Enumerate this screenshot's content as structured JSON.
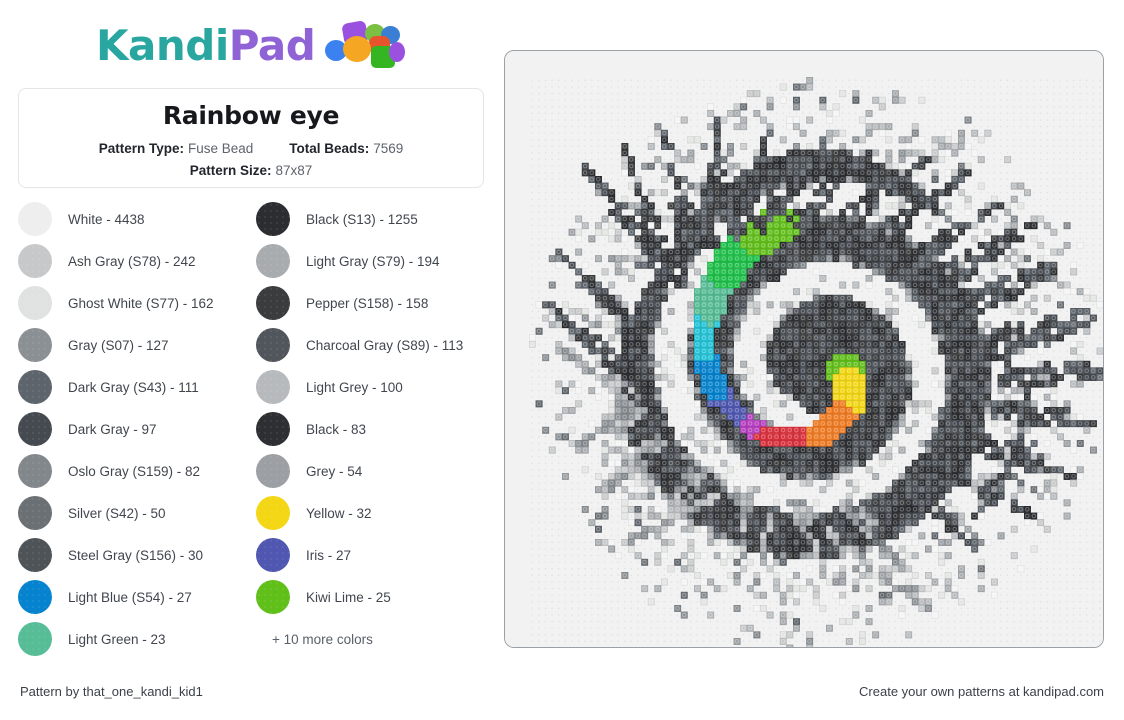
{
  "brand": {
    "name_part1": "Kandi",
    "name_part2": "Pad",
    "colors": {
      "teal": "#2aa6a0",
      "purple": "#8f63d6"
    }
  },
  "card": {
    "title": "Rainbow eye",
    "pattern_type_label": "Pattern Type:",
    "pattern_type_value": "Fuse Bead",
    "total_beads_label": "Total Beads:",
    "total_beads_value": "7569",
    "pattern_size_label": "Pattern Size:",
    "pattern_size_value": "87x87"
  },
  "legend": {
    "more_text": "+ 10 more colors",
    "items": [
      {
        "label": "White - 4438",
        "name": "White",
        "count": 4438,
        "hex": "#eeeeee"
      },
      {
        "label": "Black (S13) - 1255",
        "name": "Black (S13)",
        "count": 1255,
        "hex": "#2b2d30"
      },
      {
        "label": "Ash Gray (S78) - 242",
        "name": "Ash Gray (S78)",
        "count": 242,
        "hex": "#c6c8c9"
      },
      {
        "label": "Light Gray (S79) - 194",
        "name": "Light Gray (S79)",
        "count": 194,
        "hex": "#a8acaf"
      },
      {
        "label": "Ghost White (S77) - 162",
        "name": "Ghost White (S77)",
        "count": 162,
        "hex": "#dfe2e0"
      },
      {
        "label": "Pepper (S158) - 158",
        "name": "Pepper (S158)",
        "count": 158,
        "hex": "#3a3c3e"
      },
      {
        "label": "Gray (S07) - 127",
        "name": "Gray (S07)",
        "count": 127,
        "hex": "#8b9095"
      },
      {
        "label": "Charcoal Gray (S89) - 113",
        "name": "Charcoal Gray (S89)",
        "count": 113,
        "hex": "#51565c"
      },
      {
        "label": "Dark Gray (S43) - 111",
        "name": "Dark Gray (S43)",
        "count": 111,
        "hex": "#5d646b"
      },
      {
        "label": "Light Grey - 100",
        "name": "Light Grey",
        "count": 100,
        "hex": "#b7babd"
      },
      {
        "label": "Dark Gray - 97",
        "name": "Dark Gray",
        "count": 97,
        "hex": "#454a51"
      },
      {
        "label": "Black - 83",
        "name": "Black",
        "count": 83,
        "hex": "#2d2f32"
      },
      {
        "label": "Oslo Gray (S159) - 82",
        "name": "Oslo Gray (S159)",
        "count": 82,
        "hex": "#82878c"
      },
      {
        "label": "Grey - 54",
        "name": "Grey",
        "count": 54,
        "hex": "#9ca0a4"
      },
      {
        "label": "Silver (S42) - 50",
        "name": "Silver (S42)",
        "count": 50,
        "hex": "#6b7075"
      },
      {
        "label": "Yellow - 32",
        "name": "Yellow",
        "count": 32,
        "hex": "#f4d714"
      },
      {
        "label": "Steel Gray (S156) - 30",
        "name": "Steel Gray (S156)",
        "count": 30,
        "hex": "#4e5358"
      },
      {
        "label": "Iris - 27",
        "name": "Iris",
        "count": 27,
        "hex": "#4f57b0"
      },
      {
        "label": "Light Blue (S54) - 27",
        "name": "Light Blue (S54)",
        "count": 27,
        "hex": "#0583ce"
      },
      {
        "label": "Kiwi Lime - 25",
        "name": "Kiwi Lime",
        "count": 25,
        "hex": "#61bf1a"
      },
      {
        "label": "Light Green - 23",
        "name": "Light Green",
        "count": 23,
        "hex": "#57bd96"
      }
    ]
  },
  "pattern": {
    "alt": "Rainbow eye fuse bead pattern preview",
    "grid": 87,
    "background": "#f2f2f2"
  },
  "footer": {
    "left": "Pattern by that_one_kandi_kid1",
    "right": "Create your own patterns at kandipad.com"
  }
}
